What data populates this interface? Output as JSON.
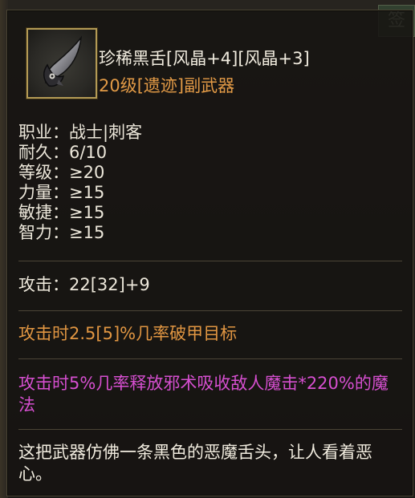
{
  "item": {
    "name": "珍稀黑舌[风晶+4][风晶+3]",
    "type": "20级[遗迹]副武器",
    "icon": "black-tongue-blade-icon"
  },
  "stats": [
    {
      "label": "职业：",
      "value": "战士|刺客"
    },
    {
      "label": "耐久：",
      "value": "6/10"
    },
    {
      "label": "等级：",
      "value": "≥20"
    },
    {
      "label": "力量：",
      "value": "≥15"
    },
    {
      "label": "敏捷：",
      "value": "≥15"
    },
    {
      "label": "智力：",
      "value": "≥15"
    }
  ],
  "attack": {
    "label": "攻击：",
    "value": "22[32]+9"
  },
  "effects": {
    "armor_break": "攻击时2.5[5]%几率破甲目标",
    "spell": "攻击时5%几率释放邪术吸收敌人魔击*220%的魔法"
  },
  "description": "这把武器仿佛一条黑色的恶魔舌头，让人看着恶心。",
  "colors": {
    "name": "#f1ecdf",
    "type": "#e29a46",
    "armor_break": "#e19642",
    "spell": "#d64fd0",
    "icon_border": "#b39a55"
  }
}
